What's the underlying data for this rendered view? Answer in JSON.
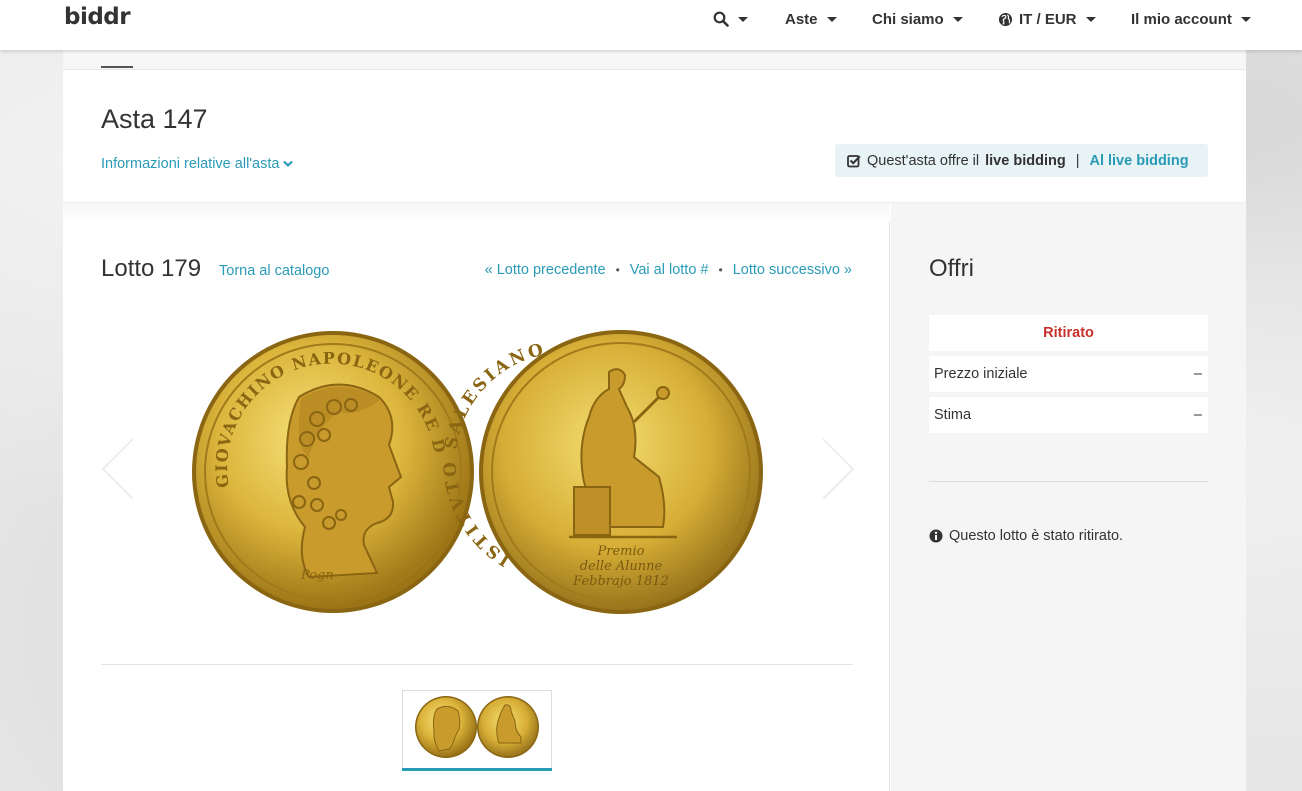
{
  "brand": {
    "logo_text": "biddr"
  },
  "nav": {
    "search_icon": "search-icon",
    "items": [
      {
        "label": "Aste"
      },
      {
        "label": "Chi siamo"
      },
      {
        "label": "IT / EUR",
        "icon": "globe-icon"
      },
      {
        "label": "Il mio account"
      }
    ]
  },
  "auction": {
    "title": "Asta 147",
    "info_link": "Informazioni relative all'asta",
    "live_box": {
      "text_prefix": "Quest'asta offre il",
      "text_bold": "live bidding",
      "separator": "|",
      "link": "Al live bidding"
    }
  },
  "lot": {
    "title": "Lotto 179",
    "back_link": "Torna al catalogo",
    "prev_link": "« Lotto precedente",
    "goto_link": "Vai al lotto #",
    "next_link": "Lotto successivo »",
    "separator": "•",
    "coin_left_legend": "GIOVACHINO NAPOLEONE RE DELLE DUE SICILIE",
    "coin_left_signature": "Pogn",
    "coin_right_legend": "ISTITVTO SALESIANO",
    "coin_right_inscription_1": "Premio",
    "coin_right_inscription_2": "delle Alunne",
    "coin_right_inscription_3": "Febbrajo 1812"
  },
  "bid": {
    "title": "Offri",
    "status": "Ritirato",
    "rows": [
      {
        "label": "Prezzo iniziale",
        "value": "–"
      },
      {
        "label": "Stima",
        "value": "–"
      }
    ],
    "note": "Questo lotto è stato ritirato.",
    "note_icon": "info-icon"
  },
  "colors": {
    "accent": "#2a9bb7",
    "status_red": "#c9302c",
    "coin_gold": "#d9b43a"
  }
}
